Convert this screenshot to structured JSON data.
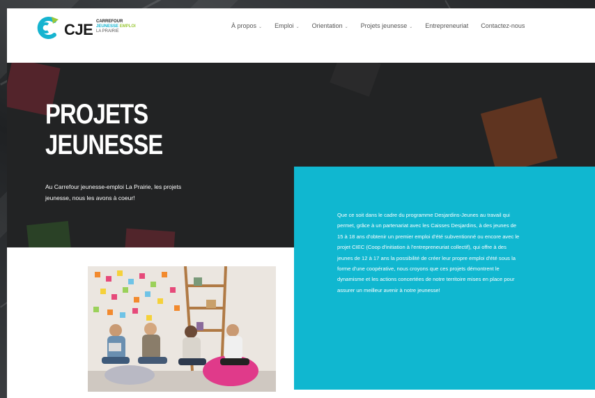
{
  "logo": {
    "mark": "cje-logo-mark",
    "name": "CJE",
    "line1": "CARREFOUR",
    "line2a": "JEUNESSE",
    "line2b": "EMPLOI",
    "line3": "LA PRAIRIE"
  },
  "nav": {
    "items": [
      {
        "label": "À propos",
        "dropdown": true
      },
      {
        "label": "Emploi",
        "dropdown": true
      },
      {
        "label": "Orientation",
        "dropdown": true
      },
      {
        "label": "Projets jeunesse",
        "dropdown": true
      },
      {
        "label": "Entrepreneuriat",
        "dropdown": false
      },
      {
        "label": "Contactez-nous",
        "dropdown": false
      }
    ]
  },
  "hero": {
    "title_line1": "PROJETS",
    "title_line2": "JEUNESSE",
    "intro": "Au Carrefour jeunesse-emploi La Prairie, les projets jeunesse, nous les avons à coeur!"
  },
  "callout": {
    "text": "Que ce soit dans le cadre du programme Desjardins-Jeunes au travail qui permet, grâce à un partenariat avec les Caisses Desjardins, à des jeunes de 15 à 18 ans d'obtenir un premier emploi d'été subventionné ou encore avec le projet CIEC (Coop d'initiation à l'entrepreneuriat collectif), qui offre à des jeunes de 12 à 17 ans la possibilité de créer leur propre emploi d'été sous la forme d'une coopérative, nous croyons que ces projets démontrent le dynamisme et les actions concertées de notre territoire mises en place pour assurer un meilleur avenir à notre jeunesse!"
  },
  "colors": {
    "teal": "#10b7d0",
    "hero_bg": "#222324",
    "logo_blue": "#16b4d0",
    "logo_green": "#9bc83a"
  },
  "photo": {
    "subject": "group-of-young-people-photo"
  }
}
